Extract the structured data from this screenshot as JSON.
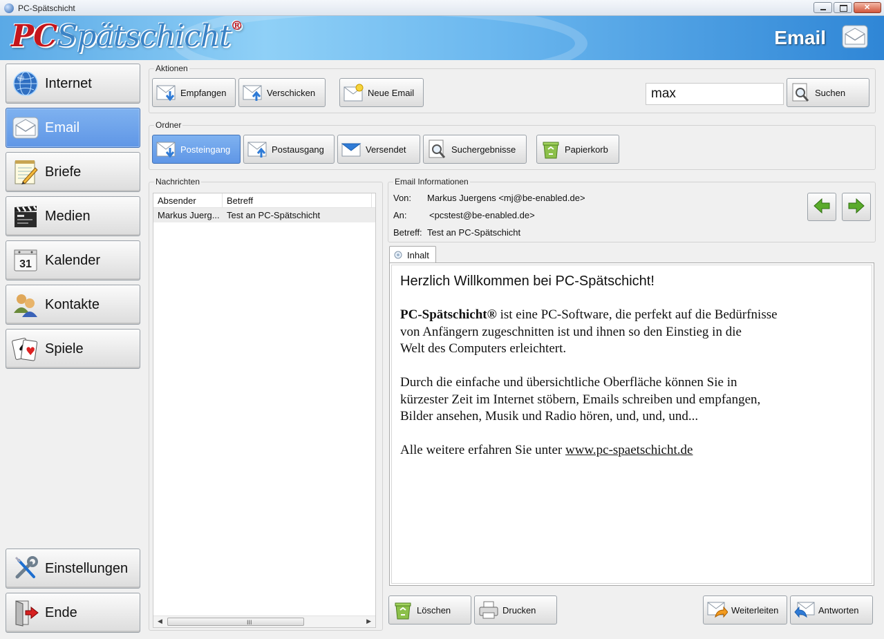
{
  "window": {
    "title": "PC-Spätschicht"
  },
  "banner": {
    "logo_pc": "PC",
    "logo_rest": "Spätschicht",
    "logo_mark": "®",
    "page_title": "Email"
  },
  "sidebar": {
    "items": [
      {
        "label": "Internet",
        "icon": "globe-icon"
      },
      {
        "label": "Email",
        "icon": "envelope-icon"
      },
      {
        "label": "Briefe",
        "icon": "notepad-icon"
      },
      {
        "label": "Medien",
        "icon": "clapperboard-icon"
      },
      {
        "label": "Kalender",
        "icon": "calendar-icon"
      },
      {
        "label": "Kontakte",
        "icon": "contacts-icon"
      },
      {
        "label": "Spiele",
        "icon": "playing-cards-icon"
      }
    ],
    "settings_label": "Einstellungen",
    "exit_label": "Ende",
    "calendar_day": "31"
  },
  "actions": {
    "title": "Aktionen",
    "receive": "Empfangen",
    "send": "Verschicken",
    "new_email": "Neue Email",
    "search_value": "max",
    "search_button": "Suchen"
  },
  "folders": {
    "title": "Ordner",
    "inbox": "Posteingang",
    "outbox": "Postausgang",
    "sent": "Versendet",
    "search_results": "Suchergebnisse",
    "trash": "Papierkorb"
  },
  "messages": {
    "title": "Nachrichten",
    "columns": [
      "Absender",
      "Betreff"
    ],
    "rows": [
      {
        "sender": "Markus Juerg...",
        "subject": "Test an PC-Spätschicht"
      }
    ],
    "scroll_grip": "III"
  },
  "email_info": {
    "title": "Email Informationen",
    "from_label": "Von:",
    "from_value": "Markus Juergens <mj@be-enabled.de>",
    "to_label": "An:",
    "to_value": "<pcstest@be-enabled.de>",
    "subject_label": "Betreff:",
    "subject_value": "Test an PC-Spätschicht"
  },
  "content": {
    "tab_label": "Inhalt",
    "heading": "Herzlich Willkommen bei PC-Spätschicht!",
    "p1_bold": "PC-Spätschicht®",
    "p1_line1": " ist eine PC-Software, die perfekt auf die Bedürfnisse",
    "p1_line2": "von Anfängern zugeschnitten ist und ihnen so den Einstieg in die",
    "p1_line3": "Welt des Computers erleichtert.",
    "p2_line1": "Durch die einfache und übersichtliche Oberfläche können Sie in",
    "p2_line2": "kürzester Zeit im Internet stöbern, Emails schreiben und empfangen,",
    "p2_line3": "Bilder ansehen, Musik und Radio hören, und, und, und...",
    "p3_text": "Alle weitere erfahren Sie unter ",
    "p3_link": "www.pc-spaetschicht.de"
  },
  "bottom": {
    "delete": "Löschen",
    "print": "Drucken",
    "forward": "Weiterleiten",
    "reply": "Antworten"
  },
  "colors": {
    "active_blue": "#6aa3ec",
    "arrow_green": "#5aab2b",
    "logo_red": "#c4151c"
  }
}
